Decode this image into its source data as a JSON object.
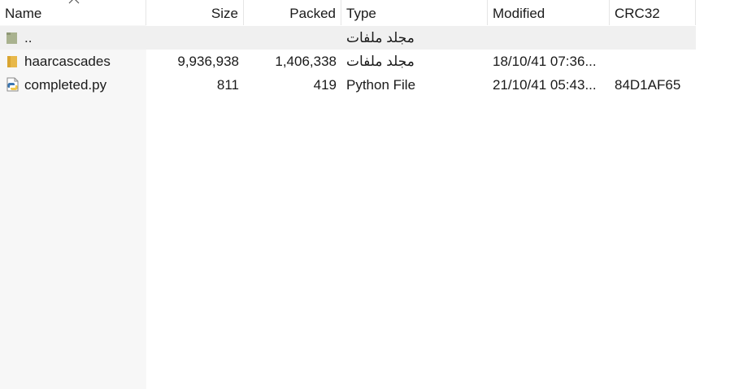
{
  "columns": {
    "name": "Name",
    "size": "Size",
    "packed": "Packed",
    "type": "Type",
    "modified": "Modified",
    "crc": "CRC32"
  },
  "rows": [
    {
      "name": "..",
      "size": "",
      "packed": "",
      "type": "مجلد ملفات",
      "modified": "",
      "crc": "",
      "icon": "folder-up-icon"
    },
    {
      "name": "haarcascades",
      "size": "9,936,938",
      "packed": "1,406,338",
      "type": "مجلد ملفات",
      "modified": "18/10/41 07:36...",
      "crc": "",
      "icon": "folder-icon"
    },
    {
      "name": "completed.py",
      "size": "811",
      "packed": "419",
      "type": "Python File",
      "modified": "21/10/41 05:43...",
      "crc": "84D1AF65",
      "icon": "python-file-icon"
    }
  ],
  "colors": {
    "selected_row": "#f0f0f0",
    "name_column_bg": "#f7f7f7",
    "folder": "#e8b84a",
    "python_blue": "#3a75b0",
    "python_yellow": "#f2c94c"
  }
}
